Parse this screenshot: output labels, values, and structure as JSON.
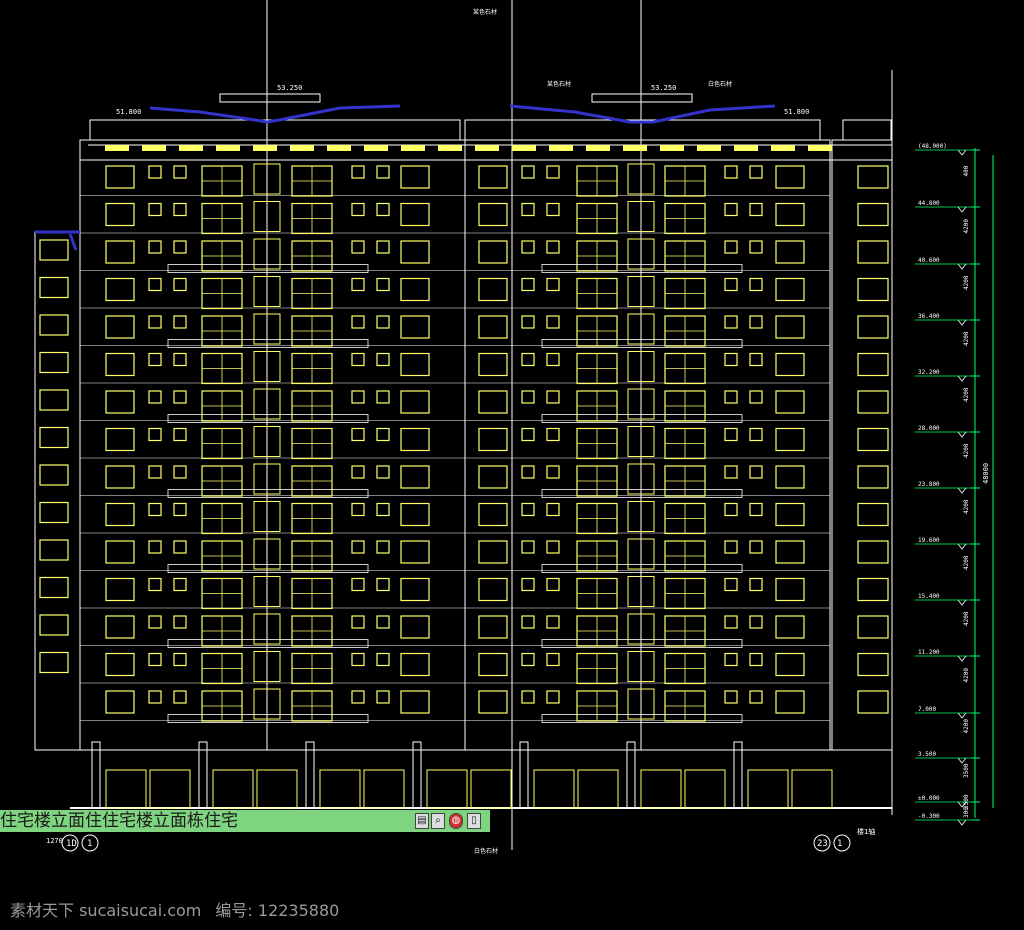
{
  "drawing": {
    "tab_title": "住宅楼立面住住宅楼立面栋住宅",
    "toolbar_icons": [
      "print-icon",
      "zoom-icon",
      "globe-icon",
      "page-icon"
    ],
    "colors": {
      "background": "#000000",
      "outline": "#ffffff",
      "window": "#ffff66",
      "roof_trim": "#3333cc",
      "dimension": "#00ff66",
      "tab_bar": "#7fd47f"
    },
    "top_labels": {
      "center_note": "某色石材",
      "right_note_1": "某色石材",
      "right_note_2": "白色石材",
      "bottom_note": "白色石材"
    },
    "roof_elevations": [
      "53.250",
      "53.250",
      "51.800",
      "51.800"
    ],
    "level_marks": [
      "(48.000)",
      "44.800",
      "40.600",
      "36.400",
      "32.200",
      "28.000",
      "23.800",
      "19.600",
      "15.400",
      "11.200",
      "7.000",
      "3.500",
      "±0.000",
      "-0.300"
    ],
    "dimension_spans": [
      "400",
      "4200",
      "4200",
      "4200",
      "4200",
      "4200",
      "4200",
      "4200",
      "4200",
      "4200",
      "4200",
      "3500",
      "3500",
      "300"
    ],
    "total_height": "48000",
    "axis_left": "1D",
    "axis_left_num": "1",
    "axis_right": "23",
    "axis_right_num": "1",
    "axis_right_note": "楼1轴",
    "left_stamp": "1270"
  },
  "watermark": {
    "site": "素材天下 sucaisucai.com",
    "code": "编号: 12235880"
  }
}
